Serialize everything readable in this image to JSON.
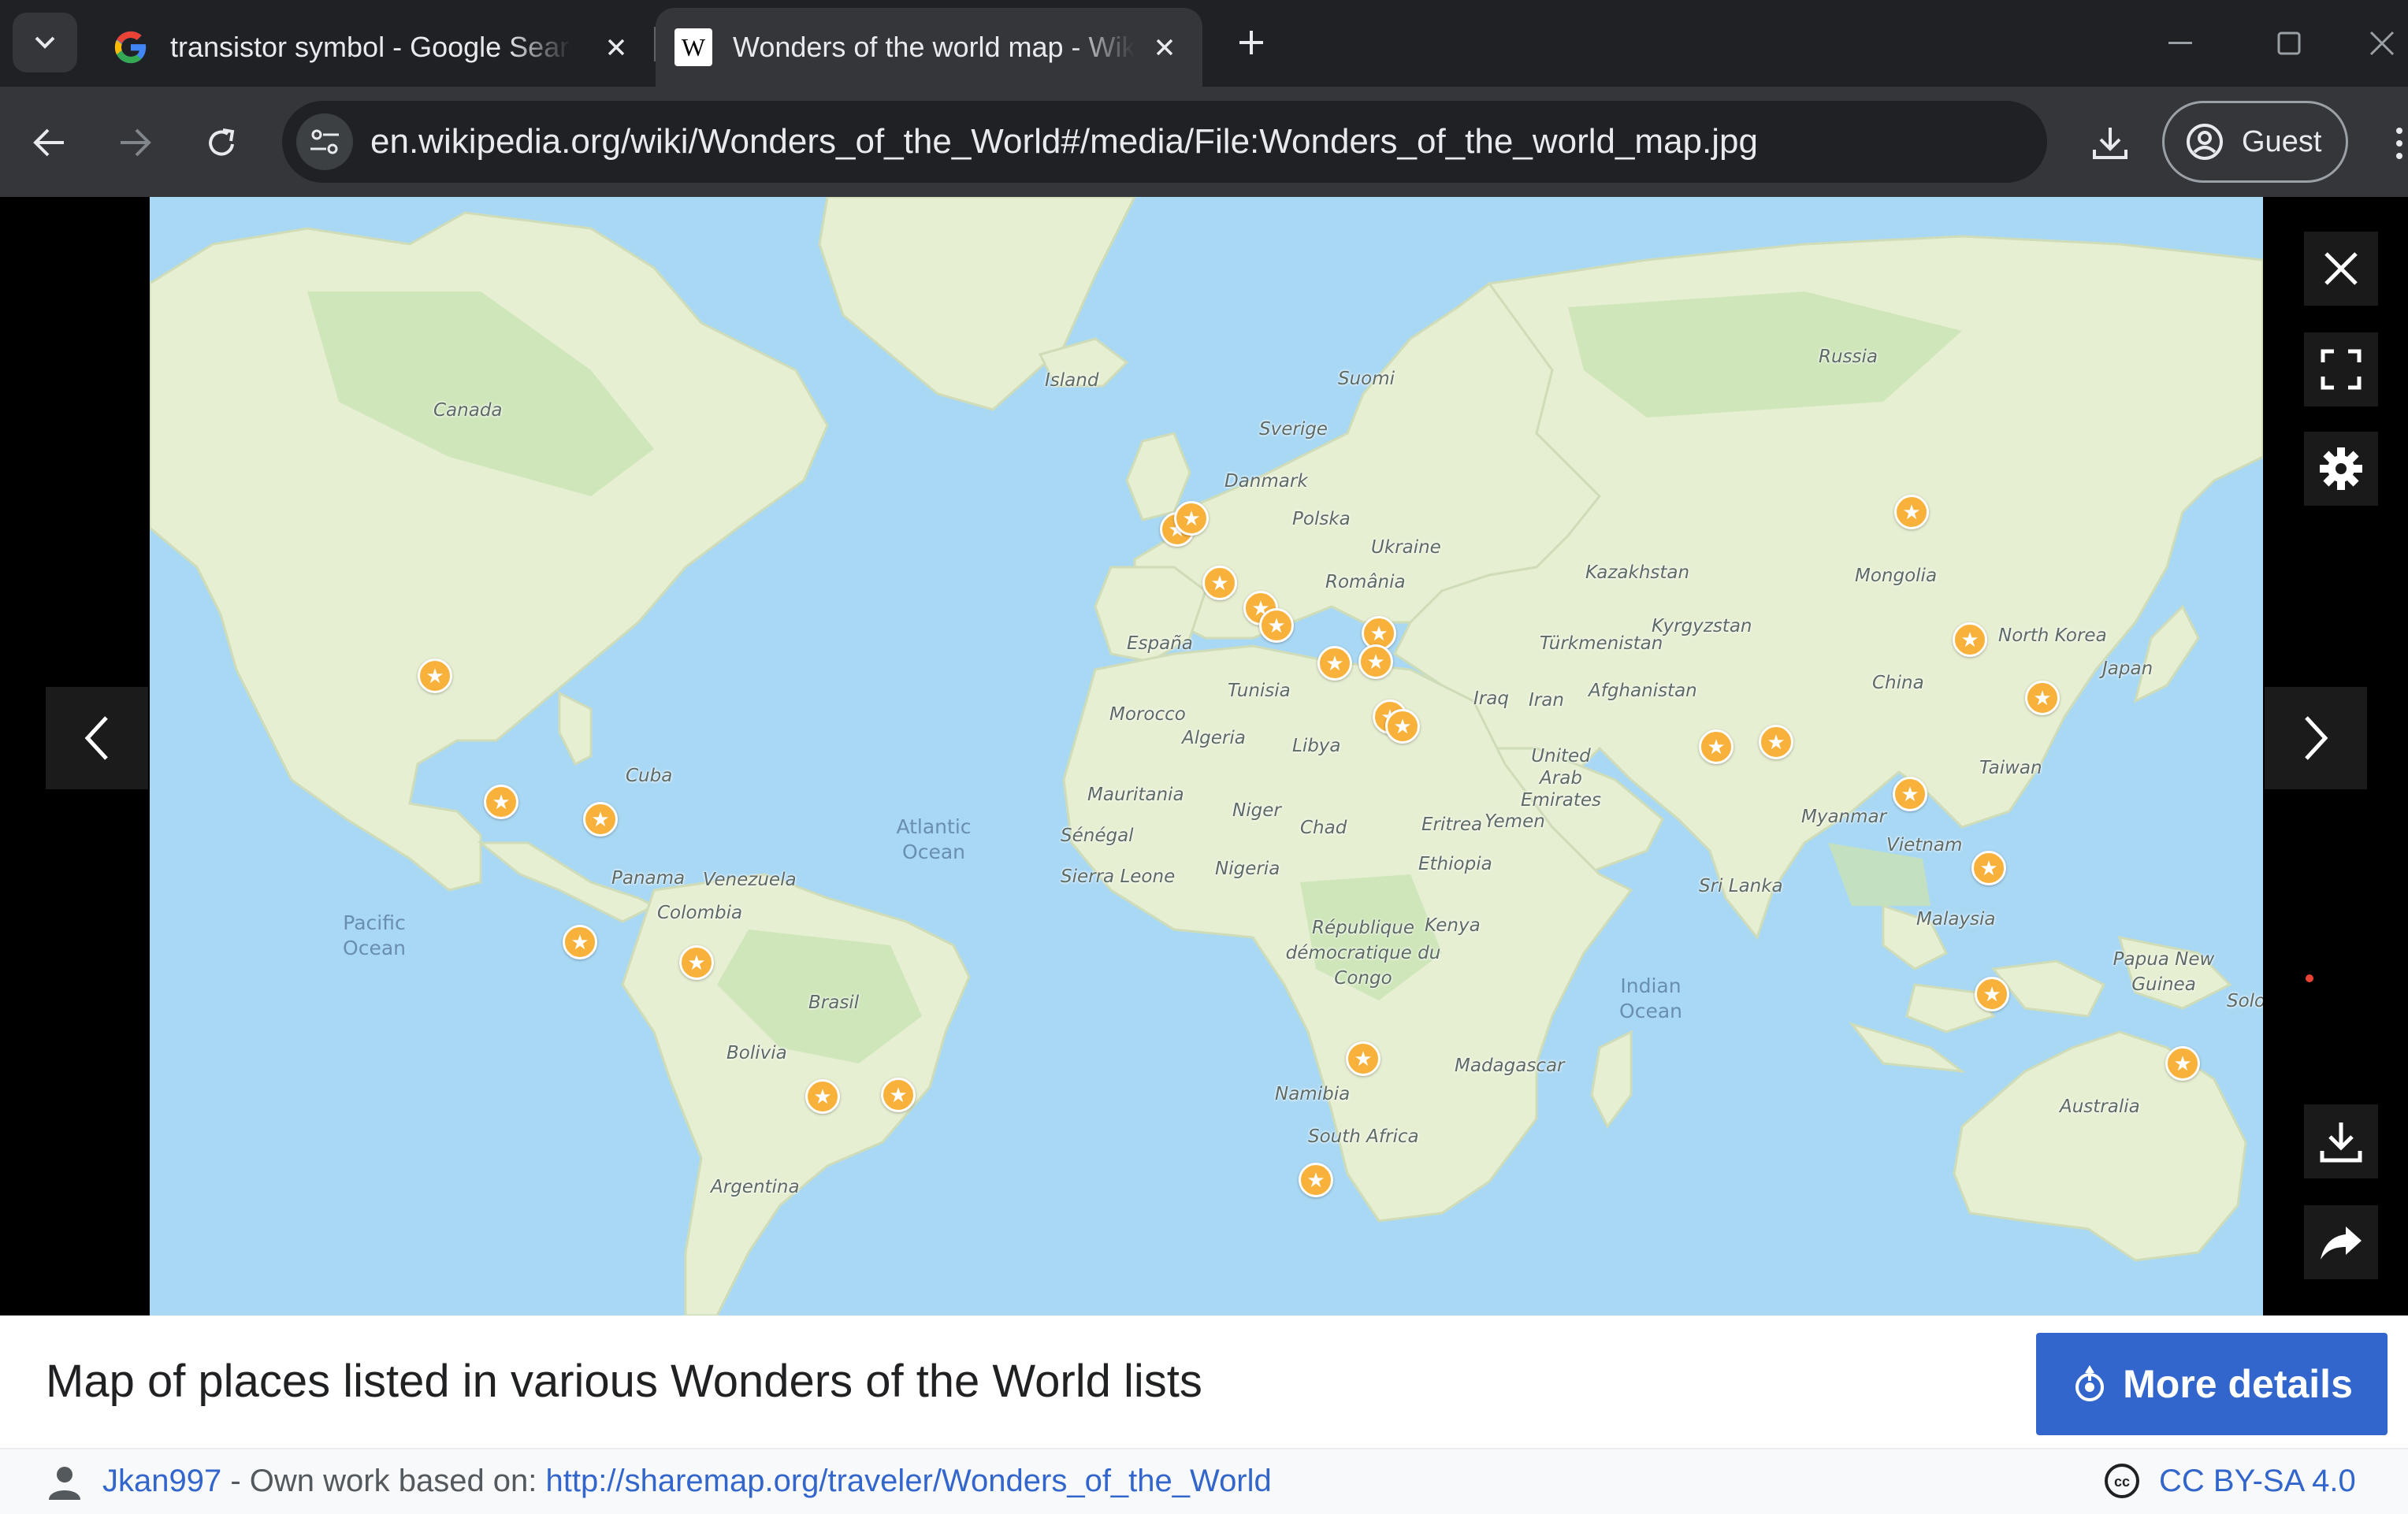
{
  "browser": {
    "tabs": [
      {
        "title": "transistor symbol - Google Search",
        "favicon": "google-icon",
        "active": false
      },
      {
        "title": "Wonders of the world map - Wikipedia",
        "favicon": "wikipedia-icon",
        "active": true
      }
    ],
    "url": "en.wikipedia.org/wiki/Wonders_of_the_World#/media/File:Wonders_of_the_world_map.jpg",
    "profile_label": "Guest"
  },
  "map": {
    "country_labels": [
      "Canada",
      "Island",
      "Suomi",
      "Sverige",
      "Russia",
      "Danmark",
      "Polska",
      "Ukraine",
      "România",
      "Kazakhstan",
      "Mongolia",
      "España",
      "Kyrgyzstan",
      "Türkmenistan",
      "North Korea",
      "Japan",
      "China",
      "Tunisia",
      "Morocco",
      "Iraq",
      "Iran",
      "Afghanistan",
      "Algeria",
      "Libya",
      "United Arab Emirates",
      "Taiwan",
      "Cuba",
      "Mauritania",
      "Niger",
      "Chad",
      "Eritrea",
      "Yemen",
      "Myanmar",
      "Vietnam",
      "Sénégal",
      "Sierra Leone",
      "Nigeria",
      "Ethiopia",
      "Sri Lanka",
      "Panama",
      "Venezuela",
      "Colombia",
      "République démocratique du Congo",
      "Kenya",
      "Malaysia",
      "Papua New Guinea",
      "Solo",
      "Brasil",
      "Bolivia",
      "Madagascar",
      "Namibia",
      "South Africa",
      "Australia",
      "Argentina"
    ],
    "ocean_labels": [
      "Atlantic Ocean",
      "Pacific Ocean",
      "Indian Ocean"
    ],
    "wonder_marker_count": 30
  },
  "caption": {
    "title": "Map of places listed in various Wonders of the World lists",
    "more_details": "More details",
    "author": "Jkan997",
    "credit_text": " - Own work based on: ",
    "source_link": "http://sharemap.org/traveler/Wonders_of_the_World",
    "license": "CC BY-SA 4.0"
  },
  "colors": {
    "chrome_dark": "#202124",
    "chrome_toolbar": "#35363a",
    "wiki_blue": "#3366cc",
    "marker": "#f8b13a",
    "ocean": "#a9d8f5",
    "land": "#e6eed0"
  }
}
